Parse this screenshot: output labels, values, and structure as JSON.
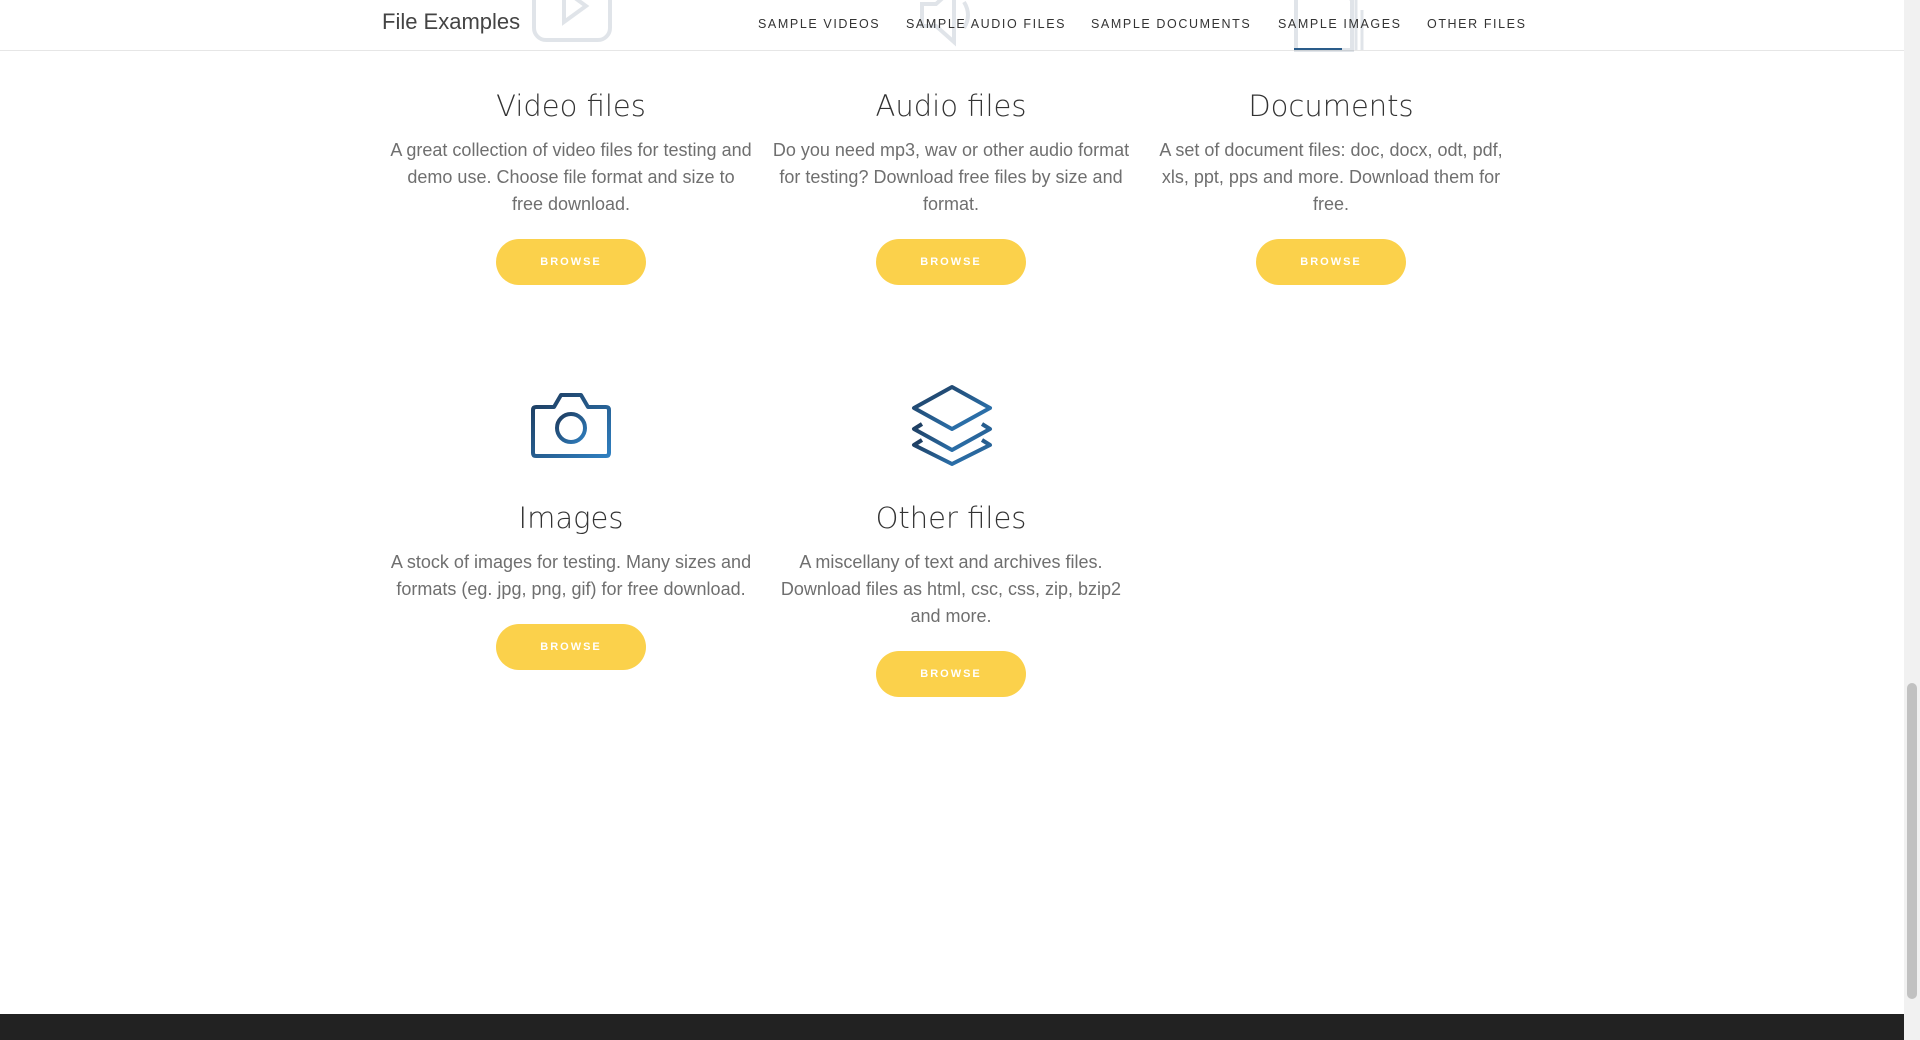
{
  "header": {
    "brand": "File Examples",
    "nav": [
      {
        "label": "SAMPLE VIDEOS"
      },
      {
        "label": "SAMPLE AUDIO FILES"
      },
      {
        "label": "SAMPLE DOCUMENTS"
      },
      {
        "label": "SAMPLE IMAGES"
      },
      {
        "label": "OTHER FILES"
      }
    ]
  },
  "cards": [
    {
      "title": "Video files",
      "description": "A great collection of video files for testing and demo use. Choose file format and size to free download.",
      "button": "BROWSE",
      "icon": "play-icon"
    },
    {
      "title": "Audio files",
      "description": "Do you need mp3, wav or other audio format for testing? Download free files by size and format.",
      "button": "BROWSE",
      "icon": "speaker-icon"
    },
    {
      "title": "Documents",
      "description": "A set of document files: doc, docx, odt, pdf, xls, ppt, pps and more. Download them for free.",
      "button": "BROWSE",
      "icon": "document-icon"
    },
    {
      "title": "Images",
      "description": "A stock of images for testing. Many sizes and formats (eg. jpg, png, gif) for free download.",
      "button": "BROWSE",
      "icon": "camera-icon"
    },
    {
      "title": "Other files",
      "description": "A miscellany of text and archives files. Download files as html, csc, css, zip, bzip2 and more.",
      "button": "BROWSE",
      "icon": "layers-icon"
    }
  ],
  "colors": {
    "button": "#fbd14b",
    "icon_dark": "#1d3a5c",
    "icon_light": "#2f7fc0",
    "footer": "#222222"
  }
}
